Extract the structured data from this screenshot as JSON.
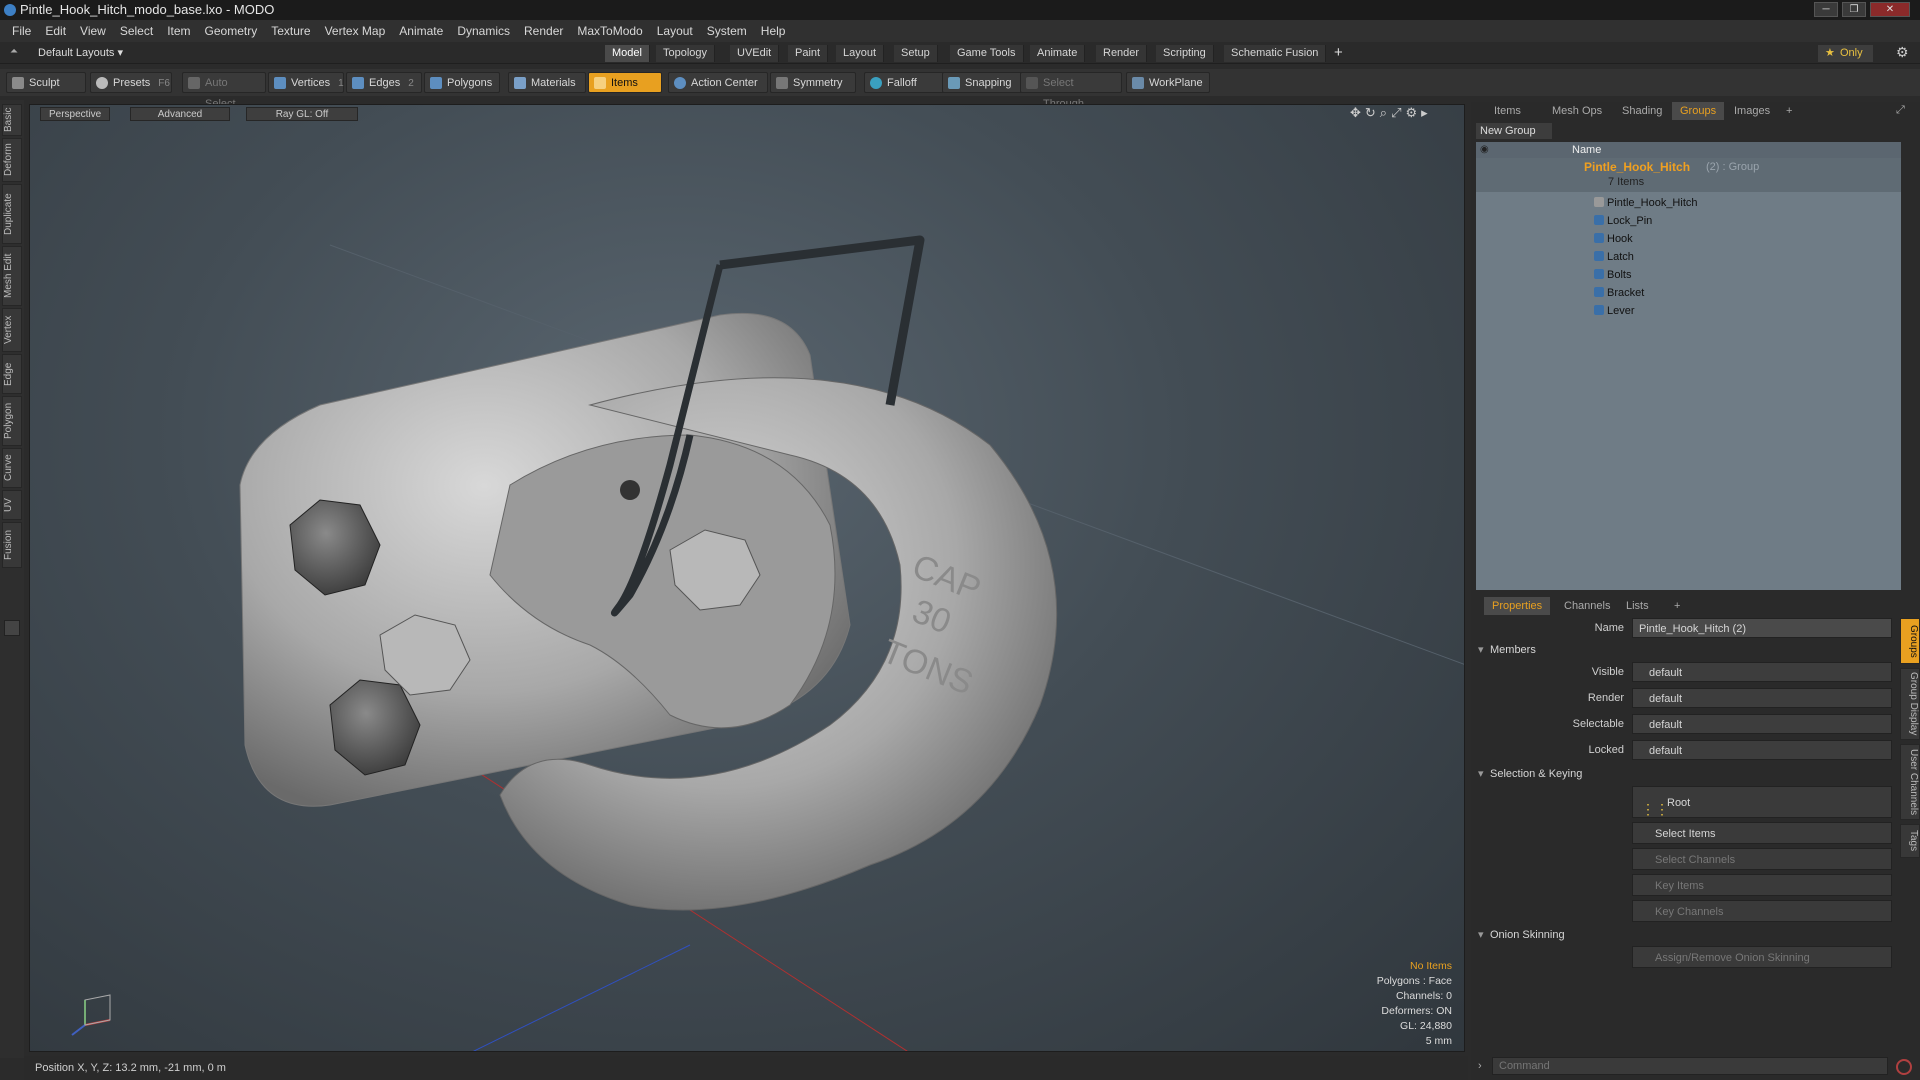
{
  "window": {
    "title": "Pintle_Hook_Hitch_modo_base.lxo - MODO",
    "buttons": [
      "─",
      "❐",
      "✕"
    ]
  },
  "menu": [
    "File",
    "Edit",
    "View",
    "Select",
    "Item",
    "Geometry",
    "Texture",
    "Vertex Map",
    "Animate",
    "Dynamics",
    "Render",
    "MaxToModo",
    "Layout",
    "System",
    "Help"
  ],
  "layouts": {
    "default_label": "Default Layouts ▾",
    "tabs": [
      "Model",
      "Topology",
      "UVEdit",
      "Paint",
      "Layout",
      "Setup",
      "Game Tools",
      "Animate",
      "Render",
      "Scripting",
      "Schematic Fusion"
    ],
    "active": "Model",
    "add": "+",
    "only_label": "Only"
  },
  "toolbar": {
    "sculpt": "Sculpt",
    "presets": "Presets",
    "presets_key": "F6",
    "auto_select": "Auto Select",
    "vertices": "Vertices",
    "vertices_key": "1",
    "edges": "Edges",
    "edges_key": "2",
    "polygons": "Polygons",
    "materials": "Materials",
    "items": "Items",
    "action_center": "Action Center",
    "symmetry": "Symmetry",
    "falloff": "Falloff",
    "snapping": "Snapping",
    "select_through": "Select Through",
    "workplane": "WorkPlane"
  },
  "left_tabs": [
    "Basic",
    "Deform",
    "Duplicate",
    "Mesh Edit",
    "Vertex",
    "Edge",
    "Polygon",
    "Curve",
    "UV",
    "Fusion"
  ],
  "viewport": {
    "perspective": "Perspective",
    "advanced": "Advanced",
    "raygl": "Ray GL: Off",
    "stats": {
      "no_items": "No Items",
      "polygons": "Polygons : Face",
      "channels": "Channels: 0",
      "deformers": "Deformers: ON",
      "gl": "GL: 24,880",
      "scale": "5 mm"
    },
    "model_text": [
      "CAP",
      "30",
      "TONS"
    ]
  },
  "status": {
    "position": "Position X, Y, Z:  13.2 mm, -21 mm, 0 m"
  },
  "groups_panel": {
    "tabs": [
      "Items",
      "Mesh Ops",
      "Shading",
      "Groups",
      "Images",
      "+"
    ],
    "active": "Groups",
    "new_group": "New Group",
    "col_name": "Name",
    "group_name": "Pintle_Hook_Hitch",
    "group_suffix": "(2) : Group",
    "item_count": "7 Items",
    "items": [
      "Pintle_Hook_Hitch",
      "Lock_Pin",
      "Hook",
      "Latch",
      "Bolts",
      "Bracket",
      "Lever"
    ]
  },
  "properties": {
    "tabs": [
      "Properties",
      "Channels",
      "Lists",
      "+"
    ],
    "active": "Properties",
    "name_label": "Name",
    "name_value": "Pintle_Hook_Hitch (2)",
    "members": "Members",
    "visible_label": "Visible",
    "visible": "default",
    "render_label": "Render",
    "render": "default",
    "selectable_label": "Selectable",
    "selectable": "default",
    "locked_label": "Locked",
    "locked": "default",
    "sel_keying": "Selection & Keying",
    "root": "Root",
    "select_items": "Select Items",
    "select_channels": "Select Channels",
    "key_items": "Key Items",
    "key_channels": "Key Channels",
    "onion": "Onion Skinning",
    "assign_onion": "Assign/Remove Onion Skinning",
    "side_tabs": [
      "Groups",
      "Group Display",
      "User Channels",
      "Tags"
    ]
  },
  "command": {
    "placeholder": "Command"
  }
}
